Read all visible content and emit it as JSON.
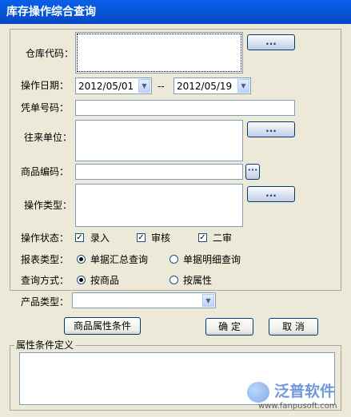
{
  "window": {
    "title": "库存操作综合查询"
  },
  "form": {
    "warehouse_code": {
      "label": "仓库代码：",
      "browse": "..."
    },
    "operation_date": {
      "label": "操作日期：",
      "from": "2012/05/01",
      "separator": "--",
      "to": "2012/05/19"
    },
    "voucher_no": {
      "label": "凭单号码：",
      "value": ""
    },
    "partner": {
      "label": "往来单位：",
      "browse": "..."
    },
    "product_code": {
      "label": "商品编码：",
      "browse": "···"
    },
    "operation_type": {
      "label": "操作类型：",
      "browse": "..."
    },
    "status": {
      "label": "操作状态：",
      "items": [
        {
          "label": "录入",
          "checked": true
        },
        {
          "label": "审核",
          "checked": true
        },
        {
          "label": "二审",
          "checked": true
        }
      ]
    },
    "report_type": {
      "label": "报表类型：",
      "options": [
        {
          "label": "单据汇总查询",
          "selected": true
        },
        {
          "label": "单据明细查询",
          "selected": false
        }
      ]
    },
    "query_mode": {
      "label": "查询方式：",
      "options": [
        {
          "label": "按商品",
          "selected": true
        },
        {
          "label": "按属性",
          "selected": false
        }
      ]
    }
  },
  "lower": {
    "product_type": {
      "label": "产品类型：",
      "value": ""
    },
    "attr_button": "商品属性条件",
    "ok_button": "确 定",
    "cancel_button": "取 消"
  },
  "attr_def": {
    "label": "属性条件定义"
  },
  "watermark": {
    "brand": "泛普软件",
    "url": "www.fanpusoft.com"
  }
}
